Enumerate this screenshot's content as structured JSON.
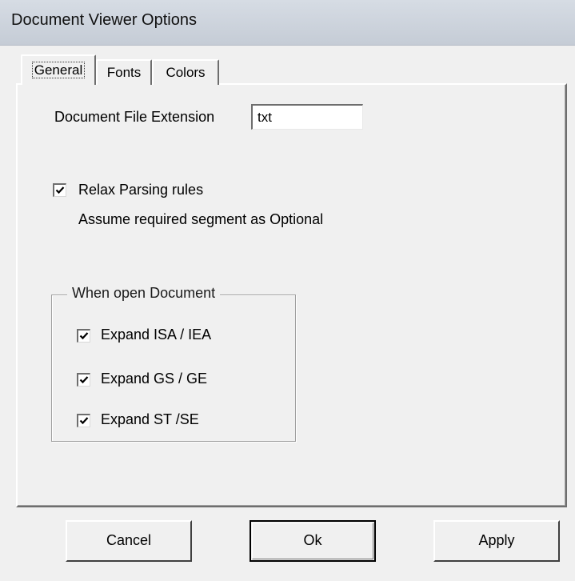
{
  "window": {
    "title": "Document Viewer Options"
  },
  "tabs": [
    {
      "label": "General",
      "selected": true
    },
    {
      "label": "Fonts",
      "selected": false
    },
    {
      "label": "Colors",
      "selected": false
    }
  ],
  "general": {
    "extension_label": "Document File Extension",
    "extension_value": "txt",
    "relax_label": "Relax Parsing rules",
    "relax_checked": true,
    "relax_description": "Assume required segment as Optional",
    "group_title": "When open Document",
    "options": [
      {
        "label": "Expand ISA / IEA",
        "checked": true
      },
      {
        "label": "Expand GS / GE",
        "checked": true
      },
      {
        "label": "Expand ST /SE",
        "checked": true
      }
    ]
  },
  "buttons": {
    "cancel": "Cancel",
    "ok": "Ok",
    "apply": "Apply"
  }
}
